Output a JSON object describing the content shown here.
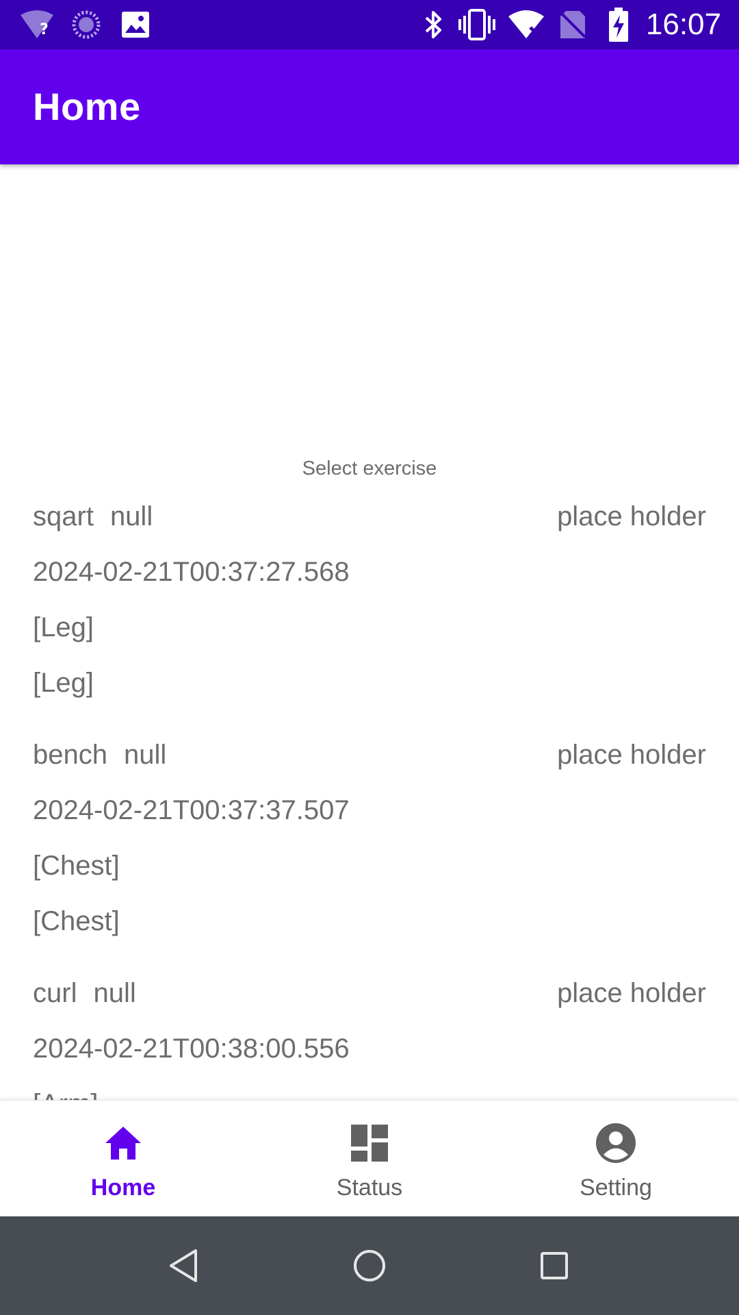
{
  "status_bar": {
    "time": "16:07",
    "icons": [
      "wifi-unknown-icon",
      "loading-icon",
      "image-icon",
      "bluetooth-icon",
      "vibrate-icon",
      "wifi-off-icon",
      "no-sim-icon",
      "battery-charging-icon"
    ]
  },
  "app_bar": {
    "title": "Home"
  },
  "main": {
    "select_label": "Select exercise",
    "records": [
      {
        "name": "sqart",
        "value": "null",
        "placeholder": "place holder",
        "timestamp": "2024-02-21T00:37:27.568",
        "tag1": "[Leg]",
        "tag2": "[Leg]"
      },
      {
        "name": "bench",
        "value": "null",
        "placeholder": "place holder",
        "timestamp": "2024-02-21T00:37:37.507",
        "tag1": "[Chest]",
        "tag2": "[Chest]"
      },
      {
        "name": "curl",
        "value": "null",
        "placeholder": "place holder",
        "timestamp": "2024-02-21T00:38:00.556",
        "tag1": "[Arm]"
      }
    ]
  },
  "bottom_nav": {
    "items": [
      {
        "label": "Home",
        "icon": "home-icon",
        "active": true
      },
      {
        "label": "Status",
        "icon": "dashboard-icon",
        "active": false
      },
      {
        "label": "Setting",
        "icon": "account-circle-icon",
        "active": false
      }
    ]
  },
  "colors": {
    "primary": "#6200ee",
    "primary_dark": "#3700b3",
    "text_gray": "#6d6d6d",
    "system_nav": "#474d52"
  }
}
